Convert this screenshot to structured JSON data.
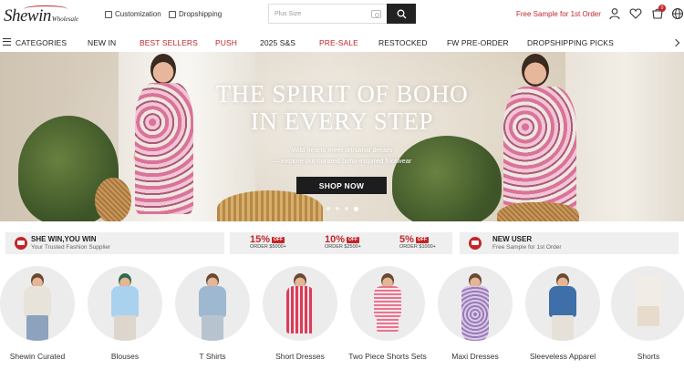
{
  "header": {
    "logo_text": "Shewin",
    "logo_sub": "Wholesale",
    "links": [
      "Customization",
      "Dropshipping"
    ],
    "search_placeholder": "Plus Size",
    "promo": "Free Sample for 1st Order",
    "cart_count": "0",
    "icons": [
      "search-icon",
      "camera-icon",
      "user-icon",
      "heart-icon",
      "cart-icon",
      "globe-icon"
    ]
  },
  "nav": {
    "items": [
      {
        "label": "CATEGORIES",
        "highlight": false
      },
      {
        "label": "NEW IN",
        "highlight": false
      },
      {
        "label": "BEST SELLERS",
        "highlight": true
      },
      {
        "label": "PUSH",
        "highlight": true
      },
      {
        "label": "2025 S&S",
        "highlight": false
      },
      {
        "label": "PRE-SALE",
        "highlight": true
      },
      {
        "label": "RESTOCKED",
        "highlight": false
      },
      {
        "label": "FW PRE-ORDER",
        "highlight": false
      },
      {
        "label": "DROPSHIPPING PICKS",
        "highlight": false
      }
    ]
  },
  "hero": {
    "title_line1": "THE SPIRIT OF BOHO",
    "title_line2": "IN EVERY STEP",
    "sub_line1": "Wild hearts meet artisanal details",
    "sub_line2": "— explore our curated boho-inspired footwear",
    "button": "SHOP NOW",
    "slides": 4,
    "active_slide": 4
  },
  "promo_strip": {
    "left_title": "SHE WIN,YOU WIN",
    "left_sub": "Your Trusted Fashion Supplier",
    "coupons": [
      {
        "pct": "15%",
        "off": "OFF",
        "order": "ORDER $5000+"
      },
      {
        "pct": "10%",
        "off": "OFF",
        "order": "ORDER $2500+"
      },
      {
        "pct": "5%",
        "off": "OFF",
        "order": "ORDER $1000+"
      }
    ],
    "right_title": "NEW USER",
    "right_sub": "Free Sample for 1st Order"
  },
  "categories": [
    {
      "label": "Shewin Curated"
    },
    {
      "label": "Blouses"
    },
    {
      "label": "T Shirts"
    },
    {
      "label": "Short Dresses"
    },
    {
      "label": "Two Piece Shorts Sets"
    },
    {
      "label": "Maxi Dresses"
    },
    {
      "label": "Sleeveless Apparel"
    },
    {
      "label": "Shorts"
    }
  ],
  "colors": {
    "accent": "#c0262c",
    "dark_button": "#1d1d1d",
    "strip_bg": "#efefef"
  }
}
